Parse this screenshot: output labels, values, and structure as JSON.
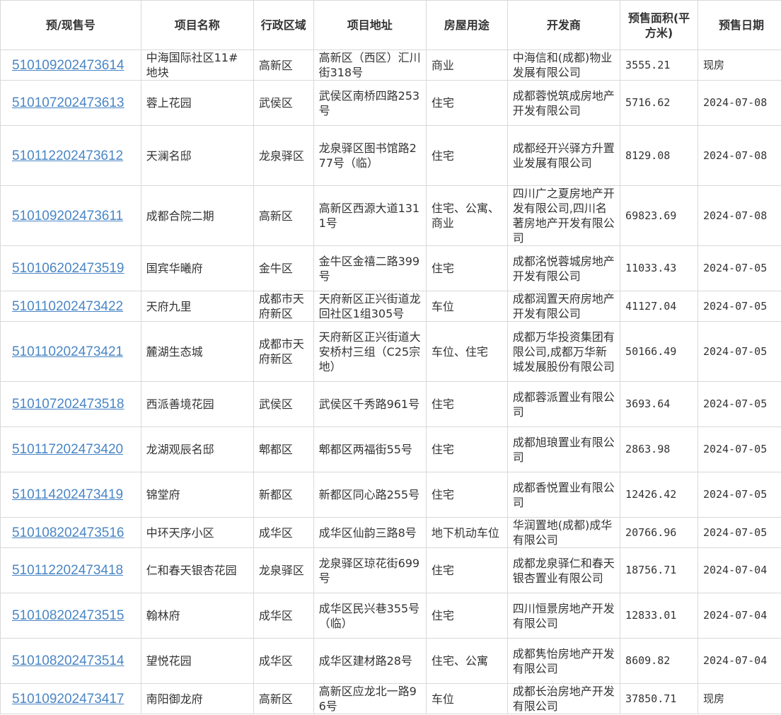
{
  "table": {
    "headers": [
      "预/现售号",
      "项目名称",
      "行政区域",
      "项目地址",
      "房屋用途",
      "开发商",
      "预售面积(平方米)",
      "预售日期"
    ],
    "rows": [
      {
        "license": "510109202473614",
        "name": "中海国际社区11#地块",
        "district": "高新区",
        "address": "高新区（西区）汇川街318号",
        "usage": "商业",
        "developer": "中海信和(成都)物业发展有限公司",
        "area": "3555.21",
        "date": "现房"
      },
      {
        "license": "510107202473613",
        "name": "蓉上花园",
        "district": "武侯区",
        "address": "武侯区南桥四路253号",
        "usage": "住宅",
        "developer": "成都蓉悦筑成房地产开发有限公司",
        "area": "5716.62",
        "date": "2024-07-08"
      },
      {
        "license": "510112202473612",
        "name": "天澜名邸",
        "district": "龙泉驿区",
        "address": "龙泉驿区图书馆路277号（临）",
        "usage": "住宅",
        "developer": "成都经开兴驿方升置业发展有限公司",
        "area": "8129.08",
        "date": "2024-07-08"
      },
      {
        "license": "510109202473611",
        "name": "成都合院二期",
        "district": "高新区",
        "address": "高新区西源大道1311号",
        "usage": "住宅、公寓、商业",
        "developer": "四川广之夏房地产开发有限公司,四川名著房地产开发有限公司",
        "area": "69823.69",
        "date": "2024-07-08"
      },
      {
        "license": "510106202473519",
        "name": "国宾华曦府",
        "district": "金牛区",
        "address": "金牛区金禧二路399号",
        "usage": "住宅",
        "developer": "成都洺悦蓉城房地产开发有限公司",
        "area": "11033.43",
        "date": "2024-07-05"
      },
      {
        "license": "510110202473422",
        "name": "天府九里",
        "district": "成都市天府新区",
        "address": "天府新区正兴街道龙回社区1组305号",
        "usage": "车位",
        "developer": "成都润置天府房地产开发有限公司",
        "area": "41127.04",
        "date": "2024-07-05"
      },
      {
        "license": "510110202473421",
        "name": "麓湖生态城",
        "district": "成都市天府新区",
        "address": "天府新区正兴街道大安桥村三组（C25宗地）",
        "usage": "车位、住宅",
        "developer": "成都万华投资集团有限公司,成都万华新城发展股份有限公司",
        "area": "50166.49",
        "date": "2024-07-05"
      },
      {
        "license": "510107202473518",
        "name": "西派善境花园",
        "district": "武侯区",
        "address": "武侯区千秀路961号",
        "usage": "住宅",
        "developer": "成都蓉派置业有限公司",
        "area": "3693.64",
        "date": "2024-07-05"
      },
      {
        "license": "510117202473420",
        "name": "龙湖观辰名邸",
        "district": "郫都区",
        "address": "郫都区两福街55号",
        "usage": "住宅",
        "developer": "成都旭琅置业有限公司",
        "area": "2863.98",
        "date": "2024-07-05"
      },
      {
        "license": "510114202473419",
        "name": "锦堂府",
        "district": "新都区",
        "address": "新都区同心路255号",
        "usage": "住宅",
        "developer": "成都香悦置业有限公司",
        "area": "12426.42",
        "date": "2024-07-05"
      },
      {
        "license": "510108202473516",
        "name": "中环天序小区",
        "district": "成华区",
        "address": "成华区仙韵三路8号",
        "usage": "地下机动车位",
        "developer": "华润置地(成都)成华有限公司",
        "area": "20766.96",
        "date": "2024-07-05"
      },
      {
        "license": "510112202473418",
        "name": "仁和春天银杏花园",
        "district": "龙泉驿区",
        "address": "龙泉驿区琼花街699号",
        "usage": "住宅",
        "developer": "成都龙泉驿仁和春天银杏置业有限公司",
        "area": "18756.71",
        "date": "2024-07-04"
      },
      {
        "license": "510108202473515",
        "name": "翰林府",
        "district": "成华区",
        "address": "成华区民兴巷355号（临）",
        "usage": "住宅",
        "developer": "四川恒景房地产开发有限公司",
        "area": "12833.01",
        "date": "2024-07-04"
      },
      {
        "license": "510108202473514",
        "name": "望悦花园",
        "district": "成华区",
        "address": "成华区建材路28号",
        "usage": "住宅、公寓",
        "developer": "成都隽怡房地产开发有限公司",
        "area": "8609.82",
        "date": "2024-07-04"
      },
      {
        "license": "510109202473417",
        "name": "南阳御龙府",
        "district": "高新区",
        "address": "高新区应龙北一路96号",
        "usage": "车位",
        "developer": "成都长治房地产开发有限公司",
        "area": "37850.71",
        "date": "现房"
      }
    ]
  },
  "colors": {
    "link": "#4a86c5",
    "border": "#d9d9d9",
    "text": "#333333"
  }
}
